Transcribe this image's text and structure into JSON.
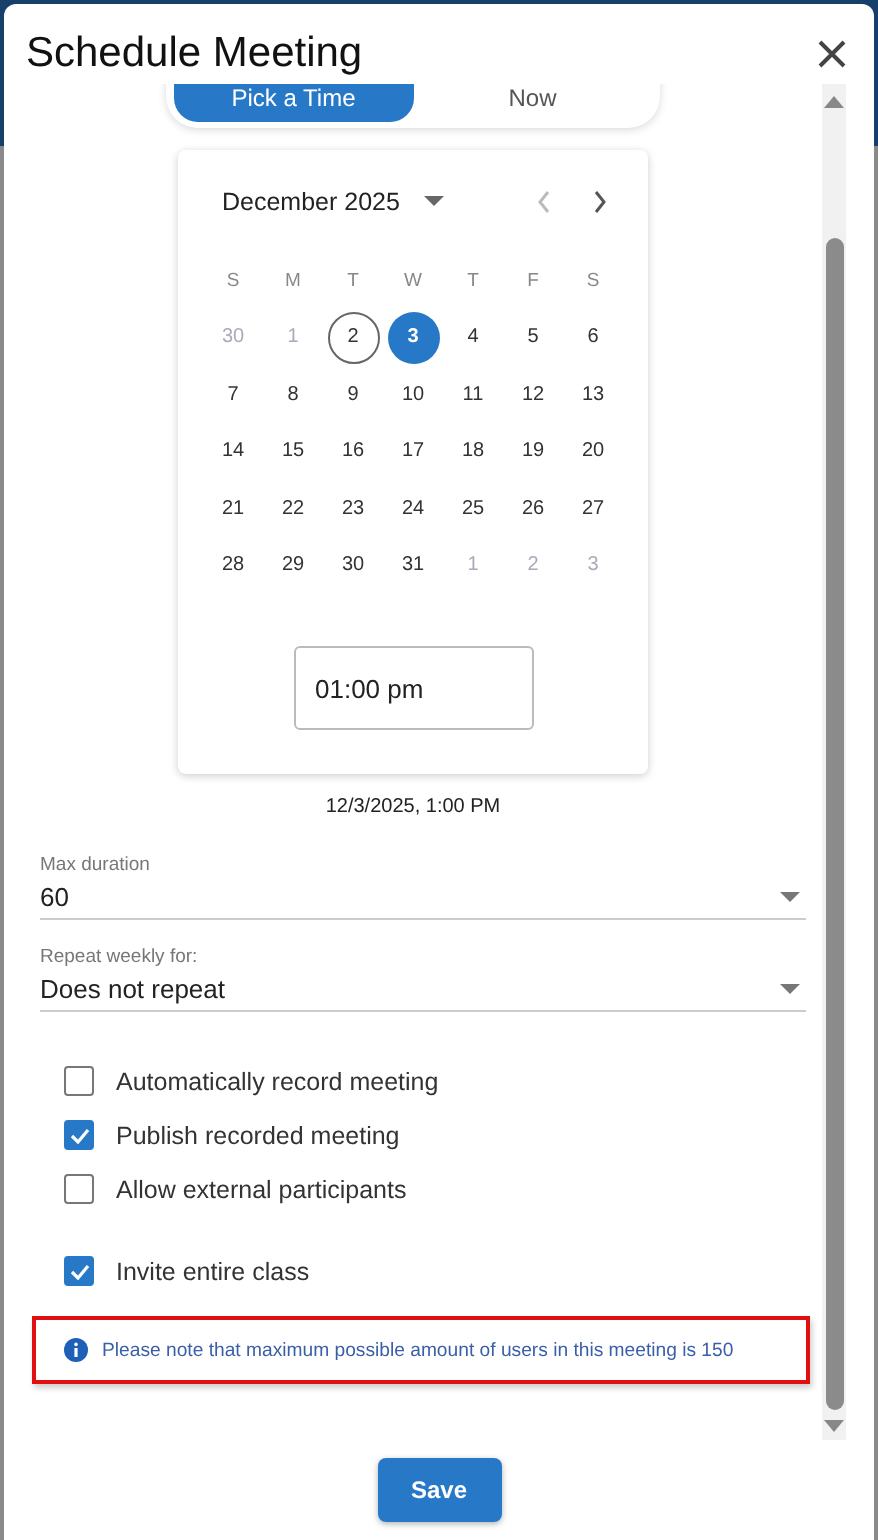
{
  "dialog": {
    "title": "Schedule Meeting"
  },
  "mode_tabs": [
    {
      "label": "Pick a Time",
      "selected": true
    },
    {
      "label": "Now",
      "selected": false
    }
  ],
  "calendar": {
    "month": "December 2025",
    "weekdays": [
      "S",
      "M",
      "T",
      "W",
      "T",
      "F",
      "S"
    ],
    "weeks": [
      [
        {
          "day": "30",
          "outside": true,
          "today": false,
          "selected": false
        },
        {
          "day": "1",
          "outside": true,
          "today": false,
          "selected": false
        },
        {
          "day": "2",
          "outside": false,
          "today": true,
          "selected": false
        },
        {
          "day": "3",
          "outside": false,
          "today": false,
          "selected": true
        },
        {
          "day": "4",
          "outside": false,
          "today": false,
          "selected": false
        },
        {
          "day": "5",
          "outside": false,
          "today": false,
          "selected": false
        },
        {
          "day": "6",
          "outside": false,
          "today": false,
          "selected": false
        }
      ],
      [
        {
          "day": "7",
          "outside": false,
          "today": false,
          "selected": false
        },
        {
          "day": "8",
          "outside": false,
          "today": false,
          "selected": false
        },
        {
          "day": "9",
          "outside": false,
          "today": false,
          "selected": false
        },
        {
          "day": "10",
          "outside": false,
          "today": false,
          "selected": false
        },
        {
          "day": "11",
          "outside": false,
          "today": false,
          "selected": false
        },
        {
          "day": "12",
          "outside": false,
          "today": false,
          "selected": false
        },
        {
          "day": "13",
          "outside": false,
          "today": false,
          "selected": false
        }
      ],
      [
        {
          "day": "14",
          "outside": false,
          "today": false,
          "selected": false
        },
        {
          "day": "15",
          "outside": false,
          "today": false,
          "selected": false
        },
        {
          "day": "16",
          "outside": false,
          "today": false,
          "selected": false
        },
        {
          "day": "17",
          "outside": false,
          "today": false,
          "selected": false
        },
        {
          "day": "18",
          "outside": false,
          "today": false,
          "selected": false
        },
        {
          "day": "19",
          "outside": false,
          "today": false,
          "selected": false
        },
        {
          "day": "20",
          "outside": false,
          "today": false,
          "selected": false
        }
      ],
      [
        {
          "day": "21",
          "outside": false,
          "today": false,
          "selected": false
        },
        {
          "day": "22",
          "outside": false,
          "today": false,
          "selected": false
        },
        {
          "day": "23",
          "outside": false,
          "today": false,
          "selected": false
        },
        {
          "day": "24",
          "outside": false,
          "today": false,
          "selected": false
        },
        {
          "day": "25",
          "outside": false,
          "today": false,
          "selected": false
        },
        {
          "day": "26",
          "outside": false,
          "today": false,
          "selected": false
        },
        {
          "day": "27",
          "outside": false,
          "today": false,
          "selected": false
        }
      ],
      [
        {
          "day": "28",
          "outside": false,
          "today": false,
          "selected": false
        },
        {
          "day": "29",
          "outside": false,
          "today": false,
          "selected": false
        },
        {
          "day": "30",
          "outside": false,
          "today": false,
          "selected": false
        },
        {
          "day": "31",
          "outside": false,
          "today": false,
          "selected": false
        },
        {
          "day": "1",
          "outside": true,
          "today": false,
          "selected": false
        },
        {
          "day": "2",
          "outside": true,
          "today": false,
          "selected": false
        },
        {
          "day": "3",
          "outside": true,
          "today": false,
          "selected": false
        }
      ]
    ]
  },
  "time_field": {
    "value": "01:00 pm"
  },
  "summary": "12/3/2025, 1:00 PM",
  "max_duration": {
    "label": "Max duration",
    "value": "60"
  },
  "repeat": {
    "label": "Repeat weekly for:",
    "value": "Does not repeat"
  },
  "options": [
    {
      "label": "Automatically record meeting",
      "checked": false
    },
    {
      "label": "Publish recorded meeting",
      "checked": true
    },
    {
      "label": "Allow external participants",
      "checked": false
    }
  ],
  "invite_option": {
    "label": "Invite entire class",
    "checked": true
  },
  "notice": {
    "text": "Please note that maximum possible amount of users in this meeting is 150"
  },
  "save_button": "Save"
}
